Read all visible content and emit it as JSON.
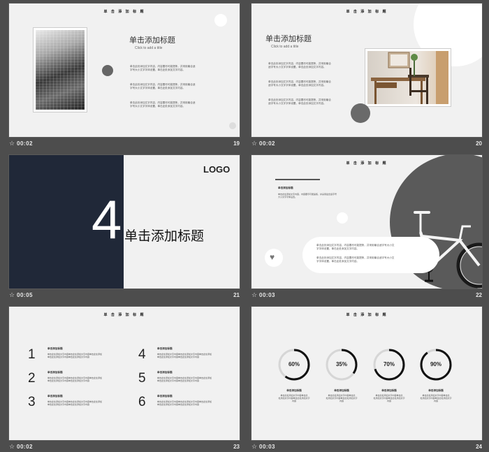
{
  "slides": [
    {
      "id": "s19",
      "time": "00:02",
      "number": "19",
      "header": "单 击 添 加 标 题",
      "title": "单击添加标题",
      "subtitle": "Click to add a title",
      "paragraphs": [
        [
          "单击此处添加文字内容，内容要尽可能提炼，并采用最合适",
          "字号大小文字字体设置，单击此处添加文字内容。"
        ],
        [
          "单击此处添加文字内容，内容要尽可能提炼，并采用最合适",
          "字号大小文字字体设置，单击此处添加文字内容。"
        ],
        [
          "单击此处添加文字内容，内容要尽可能提炼，并采用最合适",
          "字号大小文字字体设置，单击此处添加文字内容。"
        ]
      ]
    },
    {
      "id": "s20",
      "time": "00:02",
      "number": "20",
      "header": "单 击 添 加 标 题",
      "title": "单击添加标题",
      "subtitle": "Click to add a title",
      "paragraphs": [
        [
          "单击此处添加文字内容，内容要尽可能提炼，并采用最合",
          "适字号大小文字字体设置，单击此处添加文字内容。"
        ],
        [
          "单击此处添加文字内容，内容要尽可能提炼，并采用最合",
          "适字号大小文字字体设置，单击此处添加文字内容。"
        ],
        [
          "单击此处添加文字内容，内容要尽可能提炼，并采用最合",
          "适字号大小文字字体设置，单击此处添加文字内容。"
        ]
      ]
    },
    {
      "id": "s21",
      "time": "00:05",
      "number": "21",
      "logo": "LOGO",
      "big_number": "4",
      "title": "单击添加标题"
    },
    {
      "id": "s22",
      "time": "00:03",
      "number": "22",
      "header": "单 击 添 加 标 题",
      "label": "单击添加标题",
      "small_lines": [
        "单击此处添加文字内容，内容要尽可能提炼，并采用最合适字号",
        "大小文字字体设置。"
      ],
      "callout": [
        [
          "单击此处添加文字内容，内容要尽可能提炼，并采用最合适字号大小文",
          "字字体设置，单击此处添加文字内容。"
        ],
        [
          "单击此处添加文字内容，内容要尽可能提炼，并采用最合适字号大小文",
          "字字体设置，单击此处添加文字内容。"
        ]
      ]
    },
    {
      "id": "s23",
      "time": "00:02",
      "number": "23",
      "header": "单 击 添 加 标 题",
      "items": [
        {
          "num": "1",
          "label": "单击添加标题",
          "lines": [
            "单击此处添加文字内容单击此处添加文字内容单击此处添加",
            "单击此处添加文字内容单击此处添加文字内容"
          ]
        },
        {
          "num": "2",
          "label": "单击添加标题",
          "lines": [
            "单击此处添加文字内容单击此处添加文字内容单击此处添加",
            "单击此处添加文字内容单击此处添加文字内容"
          ]
        },
        {
          "num": "3",
          "label": "单击添加标题",
          "lines": [
            "单击此处添加文字内容单击此处添加文字内容单击此处添加",
            "单击此处添加文字内容单击此处添加文字内容"
          ]
        },
        {
          "num": "4",
          "label": "单击添加标题",
          "lines": [
            "单击此处添加文字内容单击此处添加文字内容单击此处添加",
            "单击此处添加文字内容单击此处添加文字内容"
          ]
        },
        {
          "num": "5",
          "label": "单击添加标题",
          "lines": [
            "单击此处添加文字内容单击此处添加文字内容单击此处添加",
            "单击此处添加文字内容单击此处添加文字内容"
          ]
        },
        {
          "num": "6",
          "label": "单击添加标题",
          "lines": [
            "单击此处添加文字内容单击此处添加文字内容单击此处添加",
            "单击此处添加文字内容单击此处添加文字内容"
          ]
        }
      ]
    },
    {
      "id": "s24",
      "time": "00:03",
      "number": "24",
      "header": "单 击 添 加 标 题",
      "rings": [
        {
          "value": 60,
          "text": "60%",
          "label": "单击添加标题",
          "lines": [
            "单击此处添加文字内容单击此",
            "处添加文字内容单击此处添加文字",
            "内容"
          ]
        },
        {
          "value": 35,
          "text": "35%",
          "label": "单击添加标题",
          "lines": [
            "单击此处添加文字内容单击此",
            "处添加文字内容单击此处添加文字",
            "内容"
          ]
        },
        {
          "value": 70,
          "text": "70%",
          "label": "单击添加标题",
          "lines": [
            "单击此处添加文字内容单击此",
            "处添加文字内容单击此处添加文字",
            "内容"
          ]
        },
        {
          "value": 90,
          "text": "90%",
          "label": "单击添加标题",
          "lines": [
            "单击此处添加文字内容单击此",
            "处添加文字内容单击此处添加文字",
            "内容"
          ]
        }
      ]
    }
  ],
  "colors": {
    "navy": "#202838",
    "ring": "#111111",
    "track": "#d6d6d6"
  }
}
